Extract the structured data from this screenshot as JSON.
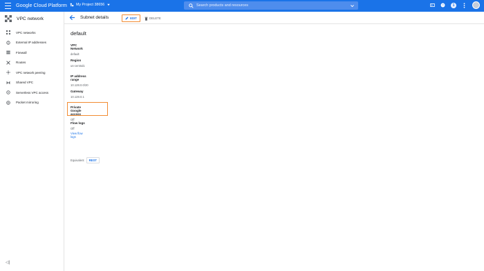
{
  "topbar": {
    "title": "Google Cloud Platform",
    "project": "My Project 38656",
    "search_placeholder": "Search products and resources",
    "badge": "1"
  },
  "sidebar": {
    "title": "VPC network",
    "items": [
      {
        "label": "VPC networks",
        "icon": "vpc-networks-icon"
      },
      {
        "label": "External IP addresses",
        "icon": "external-ip-icon"
      },
      {
        "label": "Firewall",
        "icon": "firewall-icon"
      },
      {
        "label": "Routes",
        "icon": "routes-icon"
      },
      {
        "label": "VPC network peering",
        "icon": "peering-icon"
      },
      {
        "label": "Shared VPC",
        "icon": "shared-vpc-icon"
      },
      {
        "label": "Serverless VPC access",
        "icon": "serverless-icon"
      },
      {
        "label": "Packet mirroring",
        "icon": "packet-mirroring-icon"
      }
    ],
    "collapse": "◁|"
  },
  "actionbar": {
    "title": "Subnet details",
    "edit": "EDIT",
    "delete": "DELETE"
  },
  "subnet": {
    "name": "default",
    "fields": [
      {
        "label": "VPC Network",
        "value": "default"
      },
      {
        "label": "Region",
        "value": "us-central1"
      },
      {
        "label": "IP address range",
        "value": "10.128.0.0/20"
      },
      {
        "label": "Gateway",
        "value": "10.128.0.1"
      },
      {
        "label": "Private Google access",
        "value": "Off"
      },
      {
        "label": "Flow logs",
        "value": "Off",
        "link": "View flow logs"
      }
    ],
    "equivalent": {
      "label": "Equivalent",
      "button": "REST"
    }
  },
  "colors": {
    "brand": "#1a73e8",
    "highlight": "#f28b31"
  }
}
